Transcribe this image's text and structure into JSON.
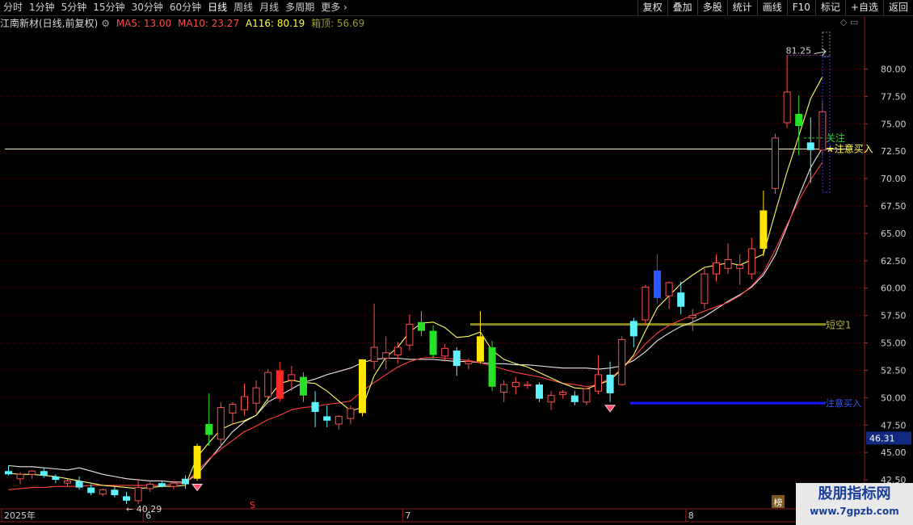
{
  "toolbar": {
    "periods": [
      "分时",
      "1分钟",
      "5分钟",
      "15分钟",
      "30分钟",
      "60分钟",
      "日线",
      "周线",
      "月线",
      "多周期",
      "更多"
    ],
    "active_period": "日线",
    "buttons": [
      "复权",
      "叠加",
      "多股",
      "统计",
      "画线",
      "F10",
      "标记",
      "+自选",
      "返回"
    ]
  },
  "info": {
    "stock": "江南新材(日线,前复权)",
    "ma5": "MA5: 13.00",
    "ma10": "MA10: 23.27",
    "a116": "A116: 80.19",
    "xd": "箱顶: 56.69"
  },
  "colors": {
    "up": "#ff4d4d",
    "down_cyan": "#5ff2ff",
    "down_green": "#27e127",
    "signal_yellow": "#ffe600",
    "signal_red": "#ff2a2a",
    "signal_blue": "#2a55ff",
    "ma_white": "#e8e8e8",
    "ma_yellow": "#ffff66",
    "ma_red": "#ff4040",
    "box_line": "#8c8c1e",
    "buy_line": "#1a1aff"
  },
  "chart_data": {
    "type": "candlestick",
    "y_ticks": [
      42.5,
      45.0,
      47.5,
      50.0,
      52.5,
      55.0,
      57.5,
      60.0,
      62.5,
      65.0,
      67.5,
      70.0,
      72.5,
      75.0,
      77.5,
      80.0
    ],
    "ylim": [
      40.0,
      83.5
    ],
    "x_labels": [
      {
        "label": "2025年",
        "index": 0
      },
      {
        "label": "6",
        "index": 12
      },
      {
        "label": "7",
        "index": 34
      },
      {
        "label": "8",
        "index": 58
      }
    ],
    "current_price_label": "46.31",
    "current_price": 46.31,
    "max_label": "81.25",
    "min_label": "← 40.29",
    "candles": [
      {
        "o": 43.3,
        "h": 43.8,
        "l": 42.9,
        "c": 43.0,
        "k": "c"
      },
      {
        "o": 42.6,
        "h": 43.2,
        "l": 42.1,
        "c": 43.0,
        "k": "u"
      },
      {
        "o": 43.0,
        "h": 43.4,
        "l": 42.6,
        "c": 43.3,
        "k": "u"
      },
      {
        "o": 43.3,
        "h": 43.6,
        "l": 42.7,
        "c": 42.9,
        "k": "c"
      },
      {
        "o": 42.8,
        "h": 43.0,
        "l": 42.2,
        "c": 42.5,
        "k": "c"
      },
      {
        "o": 42.2,
        "h": 42.6,
        "l": 41.9,
        "c": 42.4,
        "k": "u"
      },
      {
        "o": 42.4,
        "h": 42.8,
        "l": 41.6,
        "c": 41.8,
        "k": "c"
      },
      {
        "o": 41.8,
        "h": 42.1,
        "l": 41.1,
        "c": 41.3,
        "k": "c"
      },
      {
        "o": 41.2,
        "h": 41.7,
        "l": 41.0,
        "c": 41.6,
        "k": "u"
      },
      {
        "o": 41.6,
        "h": 41.9,
        "l": 40.9,
        "c": 41.1,
        "k": "c"
      },
      {
        "o": 41.0,
        "h": 41.4,
        "l": 40.3,
        "c": 40.6,
        "k": "c"
      },
      {
        "o": 40.6,
        "h": 42.6,
        "l": 40.3,
        "c": 41.8,
        "k": "u"
      },
      {
        "o": 41.7,
        "h": 42.3,
        "l": 41.4,
        "c": 42.1,
        "k": "u"
      },
      {
        "o": 42.2,
        "h": 42.4,
        "l": 41.8,
        "c": 41.9,
        "k": "c"
      },
      {
        "o": 41.9,
        "h": 42.4,
        "l": 41.6,
        "c": 42.2,
        "k": "u"
      },
      {
        "o": 42.1,
        "h": 42.9,
        "l": 41.7,
        "c": 42.6,
        "k": "c"
      },
      {
        "o": 42.6,
        "h": 45.8,
        "l": 42.4,
        "c": 45.6,
        "k": "y",
        "sig": "gem"
      },
      {
        "o": 46.6,
        "h": 50.4,
        "l": 45.6,
        "c": 47.6,
        "k": "g"
      },
      {
        "o": 46.2,
        "h": 49.6,
        "l": 45.4,
        "c": 49.1,
        "k": "u"
      },
      {
        "o": 48.6,
        "h": 49.6,
        "l": 47.6,
        "c": 49.4,
        "k": "u"
      },
      {
        "o": 48.9,
        "h": 51.3,
        "l": 48.4,
        "c": 50.1,
        "k": "u"
      },
      {
        "o": 49.5,
        "h": 51.6,
        "l": 48.6,
        "c": 50.9,
        "k": "u"
      },
      {
        "o": 50.1,
        "h": 52.6,
        "l": 49.6,
        "c": 52.3,
        "k": "u"
      },
      {
        "o": 52.5,
        "h": 53.3,
        "l": 49.6,
        "c": 49.9,
        "k": "r"
      },
      {
        "o": 51.6,
        "h": 52.9,
        "l": 50.6,
        "c": 52.1,
        "k": "u"
      },
      {
        "o": 51.9,
        "h": 52.3,
        "l": 49.6,
        "c": 50.2,
        "k": "g"
      },
      {
        "o": 49.6,
        "h": 50.6,
        "l": 47.3,
        "c": 48.7,
        "k": "c"
      },
      {
        "o": 48.3,
        "h": 49.3,
        "l": 47.3,
        "c": 47.9,
        "k": "c"
      },
      {
        "o": 47.6,
        "h": 48.4,
        "l": 47.1,
        "c": 48.3,
        "k": "u"
      },
      {
        "o": 48.1,
        "h": 49.3,
        "l": 47.6,
        "c": 49.0,
        "k": "u"
      },
      {
        "o": 48.6,
        "h": 53.5,
        "l": 48.3,
        "c": 53.5,
        "k": "y"
      },
      {
        "o": 53.3,
        "h": 58.6,
        "l": 52.6,
        "c": 54.6,
        "k": "u"
      },
      {
        "o": 53.6,
        "h": 55.6,
        "l": 52.6,
        "c": 54.1,
        "k": "u"
      },
      {
        "o": 53.9,
        "h": 55.1,
        "l": 53.1,
        "c": 54.6,
        "k": "u"
      },
      {
        "o": 54.8,
        "h": 57.6,
        "l": 54.3,
        "c": 56.7,
        "k": "u"
      },
      {
        "o": 56.9,
        "h": 57.9,
        "l": 55.6,
        "c": 56.1,
        "k": "g"
      },
      {
        "o": 56.1,
        "h": 56.6,
        "l": 53.6,
        "c": 53.9,
        "k": "g"
      },
      {
        "o": 53.8,
        "h": 54.9,
        "l": 53.3,
        "c": 54.5,
        "k": "u"
      },
      {
        "o": 54.3,
        "h": 54.6,
        "l": 52.0,
        "c": 52.9,
        "k": "c"
      },
      {
        "o": 53.1,
        "h": 53.6,
        "l": 52.6,
        "c": 53.3,
        "k": "u"
      },
      {
        "o": 53.3,
        "h": 57.9,
        "l": 53.1,
        "c": 55.6,
        "k": "y"
      },
      {
        "o": 54.6,
        "h": 55.2,
        "l": 50.6,
        "c": 51.0,
        "k": "g"
      },
      {
        "o": 50.5,
        "h": 51.6,
        "l": 49.6,
        "c": 51.2,
        "k": "u"
      },
      {
        "o": 51.0,
        "h": 51.9,
        "l": 50.3,
        "c": 51.4,
        "k": "u"
      },
      {
        "o": 51.1,
        "h": 51.5,
        "l": 50.8,
        "c": 51.2,
        "k": "u"
      },
      {
        "o": 51.2,
        "h": 51.4,
        "l": 49.6,
        "c": 49.9,
        "k": "c"
      },
      {
        "o": 49.6,
        "h": 50.6,
        "l": 48.9,
        "c": 50.2,
        "k": "u"
      },
      {
        "o": 50.3,
        "h": 50.7,
        "l": 49.9,
        "c": 50.5,
        "k": "u"
      },
      {
        "o": 50.2,
        "h": 50.6,
        "l": 49.3,
        "c": 49.6,
        "k": "c"
      },
      {
        "o": 49.6,
        "h": 50.9,
        "l": 49.3,
        "c": 50.8,
        "k": "u"
      },
      {
        "o": 50.6,
        "h": 53.9,
        "l": 50.3,
        "c": 52.1,
        "k": "u"
      },
      {
        "o": 52.1,
        "h": 53.3,
        "l": 49.6,
        "c": 50.4,
        "k": "c",
        "sig": "gem"
      },
      {
        "o": 51.2,
        "h": 55.6,
        "l": 51.1,
        "c": 55.3,
        "k": "u"
      },
      {
        "o": 55.6,
        "h": 57.3,
        "l": 54.6,
        "c": 57.0,
        "k": "c"
      },
      {
        "o": 57.1,
        "h": 60.3,
        "l": 56.6,
        "c": 60.1,
        "k": "u"
      },
      {
        "o": 61.6,
        "h": 63.1,
        "l": 58.6,
        "c": 59.1,
        "k": "b"
      },
      {
        "o": 59.3,
        "h": 60.6,
        "l": 58.1,
        "c": 60.5,
        "k": "u"
      },
      {
        "o": 59.6,
        "h": 60.6,
        "l": 57.6,
        "c": 58.3,
        "k": "c"
      },
      {
        "o": 57.3,
        "h": 58.1,
        "l": 56.1,
        "c": 57.5,
        "k": "u"
      },
      {
        "o": 58.6,
        "h": 61.9,
        "l": 58.1,
        "c": 61.3,
        "k": "u"
      },
      {
        "o": 61.3,
        "h": 63.1,
        "l": 60.6,
        "c": 62.3,
        "k": "u"
      },
      {
        "o": 61.8,
        "h": 64.1,
        "l": 61.3,
        "c": 62.6,
        "k": "u"
      },
      {
        "o": 61.8,
        "h": 63.1,
        "l": 60.3,
        "c": 62.1,
        "k": "u"
      },
      {
        "o": 61.3,
        "h": 64.6,
        "l": 60.8,
        "c": 63.6,
        "k": "u"
      },
      {
        "o": 63.6,
        "h": 68.9,
        "l": 62.9,
        "c": 67.1,
        "k": "y"
      },
      {
        "o": 69.1,
        "h": 74.1,
        "l": 68.6,
        "c": 73.7,
        "k": "u"
      },
      {
        "o": 75.1,
        "h": 81.25,
        "l": 74.6,
        "c": 77.9,
        "k": "u"
      },
      {
        "o": 75.9,
        "h": 77.6,
        "l": 72.1,
        "c": 74.8,
        "k": "g"
      },
      {
        "o": 73.3,
        "h": 75.6,
        "l": 69.6,
        "c": 72.6,
        "k": "c"
      },
      {
        "o": 72.6,
        "h": 77.1,
        "l": 72.1,
        "c": 76.1,
        "k": "u"
      }
    ],
    "ma_white": [
      43.8,
      43.7,
      43.7,
      43.6,
      43.5,
      43.4,
      43.6,
      43.3,
      43.0,
      42.8,
      42.6,
      42.5,
      42.4,
      42.4,
      42.3,
      42.3,
      43.0,
      44.3,
      45.6,
      46.9,
      47.8,
      48.4,
      49.6,
      50.2,
      50.8,
      51.4,
      51.7,
      52.1,
      52.4,
      52.7,
      53.2,
      53.5,
      53.6,
      53.6,
      53.5,
      53.5,
      53.5,
      53.4,
      53.3,
      53.3,
      53.2,
      53.1,
      53.1,
      53.0,
      53.0,
      52.9,
      52.8,
      52.7,
      52.7,
      52.7,
      52.6,
      52.7,
      52.9,
      53.4,
      54.2,
      55.2,
      55.9,
      56.5,
      56.9,
      57.4,
      58.1,
      58.8,
      59.4,
      60.1,
      61.2,
      63.0,
      65.6,
      68.4,
      71.0,
      72.8
    ],
    "ma_yellow": [
      43.1,
      43.0,
      43.0,
      42.9,
      42.8,
      42.6,
      42.4,
      42.2,
      42.0,
      41.9,
      41.8,
      41.7,
      41.8,
      41.9,
      41.9,
      42.0,
      44.6,
      45.9,
      47.1,
      47.6,
      47.9,
      48.4,
      49.9,
      51.3,
      51.6,
      51.4,
      51.3,
      50.6,
      49.7,
      48.8,
      49.1,
      52.0,
      53.7,
      54.6,
      56.0,
      56.8,
      56.9,
      56.4,
      55.5,
      55.6,
      56.0,
      54.3,
      53.5,
      53.1,
      52.8,
      52.3,
      51.8,
      51.3,
      50.9,
      50.8,
      51.2,
      51.6,
      52.6,
      53.9,
      56.1,
      58.2,
      59.3,
      60.4,
      61.2,
      61.9,
      62.1,
      62.3,
      62.1,
      62.6,
      63.1,
      66.9,
      70.6,
      73.9,
      77.3,
      79.3
    ],
    "ma_red": [
      41.6,
      41.7,
      41.8,
      41.8,
      41.9,
      41.9,
      41.9,
      42.0,
      42.0,
      42.0,
      42.0,
      42.0,
      42.0,
      42.0,
      42.1,
      42.2,
      43.3,
      44.4,
      45.3,
      46.1,
      46.9,
      47.4,
      48.0,
      48.4,
      48.9,
      49.1,
      49.2,
      49.4,
      49.5,
      49.7,
      50.6,
      51.4,
      52.1,
      52.8,
      53.3,
      53.6,
      53.7,
      53.6,
      53.5,
      53.4,
      53.2,
      52.9,
      52.6,
      52.3,
      52.1,
      51.9,
      51.6,
      51.3,
      51.2,
      51.0,
      51.2,
      51.8,
      52.6,
      53.7,
      54.9,
      55.9,
      56.6,
      57.1,
      57.5,
      57.9,
      58.3,
      58.7,
      59.3,
      60.2,
      61.4,
      63.5,
      65.8,
      68.0,
      69.9,
      71.5
    ],
    "box_top": 56.69,
    "box_label": "短空1",
    "white_hline": 72.7,
    "attention_line": 73.7,
    "attention_label": "关注",
    "buy_label_top": "★注意买入",
    "buy_line": 49.5,
    "buy_label_bottom": "注意买入",
    "markers": {
      "s_label": "S",
      "bang_label": "榜"
    }
  },
  "watermark": {
    "line1": "股朋指标网",
    "line2": "www.7gpzb.com"
  }
}
